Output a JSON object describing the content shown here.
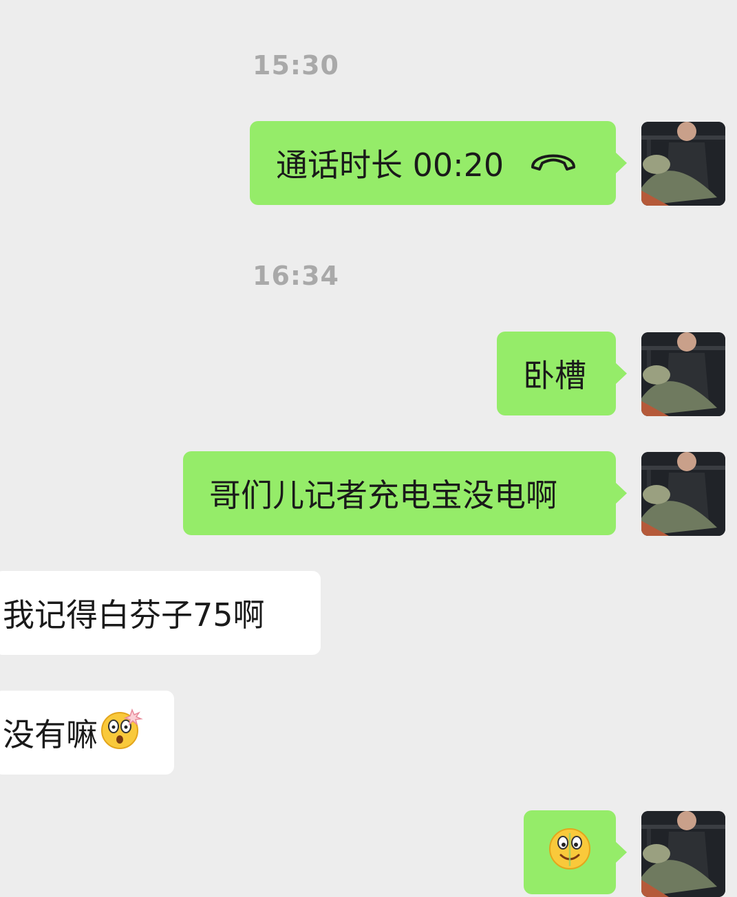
{
  "chat": {
    "timestamps": [
      "15:30",
      "16:34"
    ],
    "call": {
      "prefix": "通话时长",
      "duration": "00:20"
    },
    "msg_woc": "卧槽",
    "msg_powerbank": "哥们儿记者充电宝没电啊",
    "msg_remember": "我记得白芬子75啊",
    "msg_none": "没有嘛"
  },
  "colors": {
    "outgoing": "#95ec69",
    "incoming": "#ffffff",
    "background": "#ededed",
    "timestamp": "#a9a9a9"
  }
}
